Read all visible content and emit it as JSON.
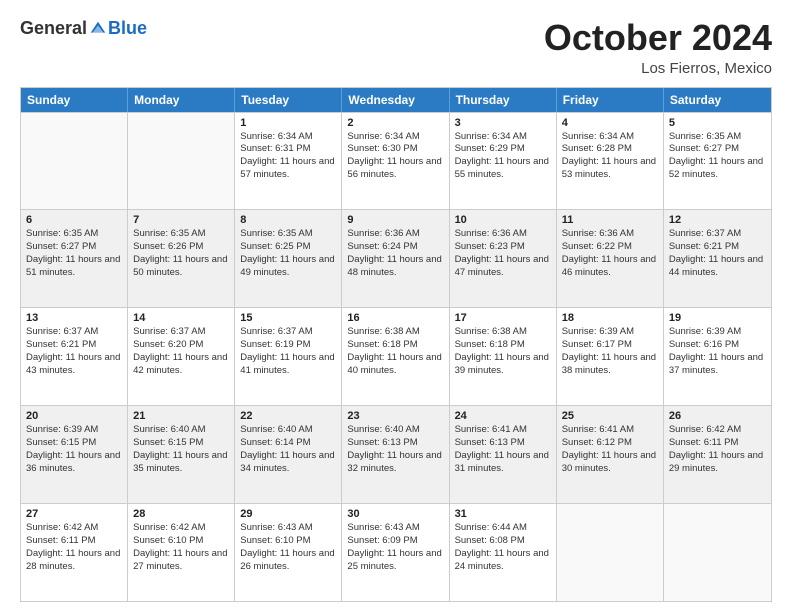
{
  "header": {
    "logo_general": "General",
    "logo_blue": "Blue",
    "month_title": "October 2024",
    "location": "Los Fierros, Mexico"
  },
  "days_of_week": [
    "Sunday",
    "Monday",
    "Tuesday",
    "Wednesday",
    "Thursday",
    "Friday",
    "Saturday"
  ],
  "weeks": [
    [
      {
        "day": "",
        "empty": true
      },
      {
        "day": "",
        "empty": true
      },
      {
        "day": "1",
        "line1": "Sunrise: 6:34 AM",
        "line2": "Sunset: 6:31 PM",
        "line3": "Daylight: 11 hours and 57 minutes."
      },
      {
        "day": "2",
        "line1": "Sunrise: 6:34 AM",
        "line2": "Sunset: 6:30 PM",
        "line3": "Daylight: 11 hours and 56 minutes."
      },
      {
        "day": "3",
        "line1": "Sunrise: 6:34 AM",
        "line2": "Sunset: 6:29 PM",
        "line3": "Daylight: 11 hours and 55 minutes."
      },
      {
        "day": "4",
        "line1": "Sunrise: 6:34 AM",
        "line2": "Sunset: 6:28 PM",
        "line3": "Daylight: 11 hours and 53 minutes."
      },
      {
        "day": "5",
        "line1": "Sunrise: 6:35 AM",
        "line2": "Sunset: 6:27 PM",
        "line3": "Daylight: 11 hours and 52 minutes."
      }
    ],
    [
      {
        "day": "6",
        "line1": "Sunrise: 6:35 AM",
        "line2": "Sunset: 6:27 PM",
        "line3": "Daylight: 11 hours and 51 minutes."
      },
      {
        "day": "7",
        "line1": "Sunrise: 6:35 AM",
        "line2": "Sunset: 6:26 PM",
        "line3": "Daylight: 11 hours and 50 minutes."
      },
      {
        "day": "8",
        "line1": "Sunrise: 6:35 AM",
        "line2": "Sunset: 6:25 PM",
        "line3": "Daylight: 11 hours and 49 minutes."
      },
      {
        "day": "9",
        "line1": "Sunrise: 6:36 AM",
        "line2": "Sunset: 6:24 PM",
        "line3": "Daylight: 11 hours and 48 minutes."
      },
      {
        "day": "10",
        "line1": "Sunrise: 6:36 AM",
        "line2": "Sunset: 6:23 PM",
        "line3": "Daylight: 11 hours and 47 minutes."
      },
      {
        "day": "11",
        "line1": "Sunrise: 6:36 AM",
        "line2": "Sunset: 6:22 PM",
        "line3": "Daylight: 11 hours and 46 minutes."
      },
      {
        "day": "12",
        "line1": "Sunrise: 6:37 AM",
        "line2": "Sunset: 6:21 PM",
        "line3": "Daylight: 11 hours and 44 minutes."
      }
    ],
    [
      {
        "day": "13",
        "line1": "Sunrise: 6:37 AM",
        "line2": "Sunset: 6:21 PM",
        "line3": "Daylight: 11 hours and 43 minutes."
      },
      {
        "day": "14",
        "line1": "Sunrise: 6:37 AM",
        "line2": "Sunset: 6:20 PM",
        "line3": "Daylight: 11 hours and 42 minutes."
      },
      {
        "day": "15",
        "line1": "Sunrise: 6:37 AM",
        "line2": "Sunset: 6:19 PM",
        "line3": "Daylight: 11 hours and 41 minutes."
      },
      {
        "day": "16",
        "line1": "Sunrise: 6:38 AM",
        "line2": "Sunset: 6:18 PM",
        "line3": "Daylight: 11 hours and 40 minutes."
      },
      {
        "day": "17",
        "line1": "Sunrise: 6:38 AM",
        "line2": "Sunset: 6:18 PM",
        "line3": "Daylight: 11 hours and 39 minutes."
      },
      {
        "day": "18",
        "line1": "Sunrise: 6:39 AM",
        "line2": "Sunset: 6:17 PM",
        "line3": "Daylight: 11 hours and 38 minutes."
      },
      {
        "day": "19",
        "line1": "Sunrise: 6:39 AM",
        "line2": "Sunset: 6:16 PM",
        "line3": "Daylight: 11 hours and 37 minutes."
      }
    ],
    [
      {
        "day": "20",
        "line1": "Sunrise: 6:39 AM",
        "line2": "Sunset: 6:15 PM",
        "line3": "Daylight: 11 hours and 36 minutes."
      },
      {
        "day": "21",
        "line1": "Sunrise: 6:40 AM",
        "line2": "Sunset: 6:15 PM",
        "line3": "Daylight: 11 hours and 35 minutes."
      },
      {
        "day": "22",
        "line1": "Sunrise: 6:40 AM",
        "line2": "Sunset: 6:14 PM",
        "line3": "Daylight: 11 hours and 34 minutes."
      },
      {
        "day": "23",
        "line1": "Sunrise: 6:40 AM",
        "line2": "Sunset: 6:13 PM",
        "line3": "Daylight: 11 hours and 32 minutes."
      },
      {
        "day": "24",
        "line1": "Sunrise: 6:41 AM",
        "line2": "Sunset: 6:13 PM",
        "line3": "Daylight: 11 hours and 31 minutes."
      },
      {
        "day": "25",
        "line1": "Sunrise: 6:41 AM",
        "line2": "Sunset: 6:12 PM",
        "line3": "Daylight: 11 hours and 30 minutes."
      },
      {
        "day": "26",
        "line1": "Sunrise: 6:42 AM",
        "line2": "Sunset: 6:11 PM",
        "line3": "Daylight: 11 hours and 29 minutes."
      }
    ],
    [
      {
        "day": "27",
        "line1": "Sunrise: 6:42 AM",
        "line2": "Sunset: 6:11 PM",
        "line3": "Daylight: 11 hours and 28 minutes."
      },
      {
        "day": "28",
        "line1": "Sunrise: 6:42 AM",
        "line2": "Sunset: 6:10 PM",
        "line3": "Daylight: 11 hours and 27 minutes."
      },
      {
        "day": "29",
        "line1": "Sunrise: 6:43 AM",
        "line2": "Sunset: 6:10 PM",
        "line3": "Daylight: 11 hours and 26 minutes."
      },
      {
        "day": "30",
        "line1": "Sunrise: 6:43 AM",
        "line2": "Sunset: 6:09 PM",
        "line3": "Daylight: 11 hours and 25 minutes."
      },
      {
        "day": "31",
        "line1": "Sunrise: 6:44 AM",
        "line2": "Sunset: 6:08 PM",
        "line3": "Daylight: 11 hours and 24 minutes."
      },
      {
        "day": "",
        "empty": true
      },
      {
        "day": "",
        "empty": true
      }
    ]
  ]
}
